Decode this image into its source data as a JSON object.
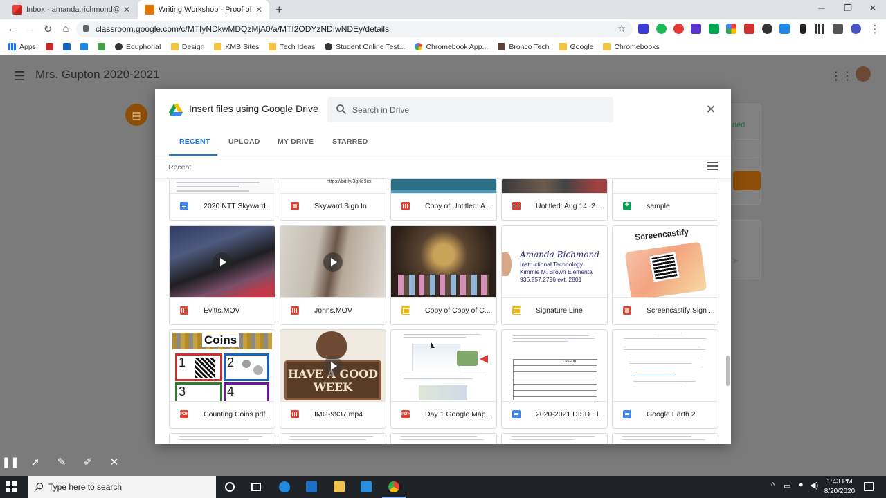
{
  "browser": {
    "tabs": [
      {
        "title": "Inbox - amanda.richmond@dayt",
        "active": false
      },
      {
        "title": "Writing Workshop - Proof of Lea",
        "active": true
      }
    ],
    "url": "classroom.google.com/c/MTIyNDkwMDQzMjA0/a/MTI2ODYzNDIwNDEy/details",
    "bookmarks": [
      "Apps",
      "Eduphoria!",
      "Design",
      "KMB Sites",
      "Tech Ideas",
      "Student Online Test...",
      "Chromebook App...",
      "Bronco Tech",
      "Google",
      "Chromebooks"
    ]
  },
  "classroom": {
    "title": "Mrs. Gupton 2020-2021",
    "side_peek": "ned"
  },
  "dialog": {
    "title": "Insert files using Google Drive",
    "search_placeholder": "Search in Drive",
    "tabs": [
      "RECENT",
      "UPLOAD",
      "MY DRIVE",
      "STARRED"
    ],
    "active_tab": "RECENT",
    "section_label": "Recent",
    "row1": [
      {
        "name": "2020 NTT Skyward...",
        "type": "doc"
      },
      {
        "name": "Skyward Sign In",
        "type": "image",
        "thumb_text": "https://bit.ly/3gXe9cx"
      },
      {
        "name": "Copy of Untitled: A...",
        "type": "video"
      },
      {
        "name": "Untitled: Aug 14, 2...",
        "type": "video"
      },
      {
        "name": "sample",
        "type": "sheet"
      }
    ],
    "row2": [
      {
        "name": "Evitts.MOV",
        "type": "video"
      },
      {
        "name": "Johns.MOV",
        "type": "video"
      },
      {
        "name": "Copy of Copy of C...",
        "type": "slide"
      },
      {
        "name": "Signature Line",
        "type": "slide",
        "thumb_lines": [
          "Amanda Richmond",
          "Instructional Technology",
          "Kimmie M. Brown Elementa",
          "936.257.2796 ext. 2801"
        ]
      },
      {
        "name": "Screencastify Sign ...",
        "type": "image",
        "thumb_text": "Screencastify"
      }
    ],
    "row3": [
      {
        "name": "Counting Coins.pdf...",
        "type": "pdf",
        "thumb_text": "Coins",
        "thumb_digits": [
          "1",
          "2",
          "3",
          "4"
        ]
      },
      {
        "name": "IMG-9937.mp4",
        "type": "video",
        "thumb_text": "HAVE A GOOD WEEK"
      },
      {
        "name": "Day 1 Google Map...",
        "type": "pdf"
      },
      {
        "name": "2020-2021 DISD El...",
        "type": "doc",
        "thumb_text": "Lesson"
      },
      {
        "name": "Google Earth 2",
        "type": "doc"
      }
    ]
  },
  "taskbar": {
    "search_placeholder": "Type here to search",
    "time": "1:43 PM",
    "date": "8/20/2020"
  },
  "colors": {
    "accent": "#1a73e8",
    "doc": "#4285f4",
    "video": "#db4437",
    "slide": "#f4b400",
    "sheet": "#0f9d58"
  }
}
